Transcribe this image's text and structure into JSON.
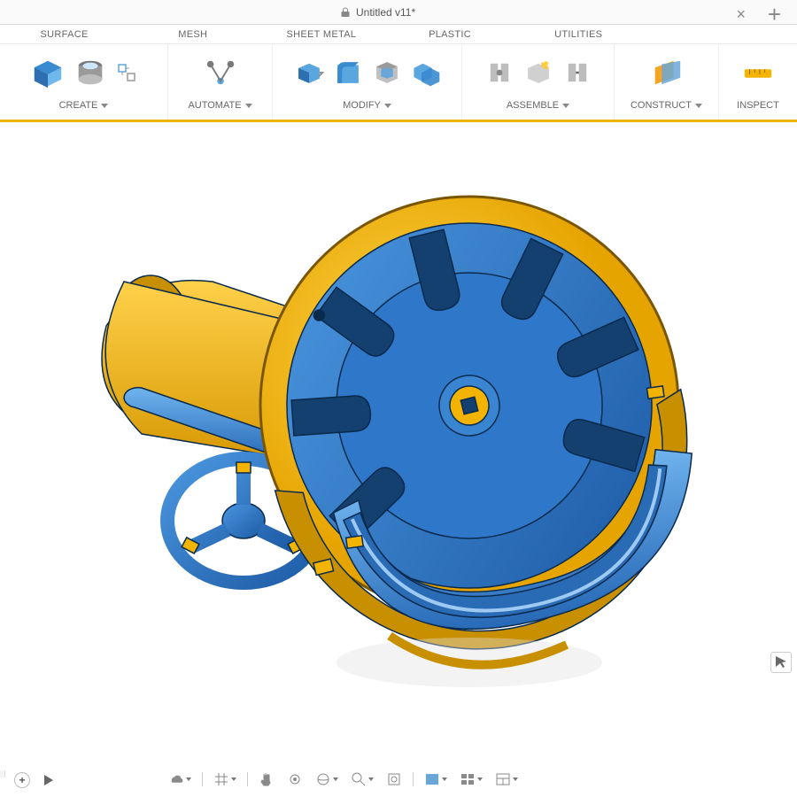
{
  "document": {
    "title": "Untitled v11*",
    "close": "×",
    "add": "+"
  },
  "panels": [
    "SURFACE",
    "MESH",
    "SHEET METAL",
    "PLASTIC",
    "UTILITIES"
  ],
  "ribbon": {
    "create": {
      "label": "CREATE"
    },
    "automate": {
      "label": "AUTOMATE"
    },
    "modify": {
      "label": "MODIFY"
    },
    "assemble": {
      "label": "ASSEMBLE"
    },
    "construct": {
      "label": "CONSTRUCT"
    },
    "inspect": {
      "label": "INSPECT"
    }
  },
  "browser": {
    "collapse": "–",
    "paren": ")"
  },
  "timeline": {
    "expand": "+"
  },
  "navbar": {
    "items": [
      "display-settings",
      "grid",
      "pan",
      "look",
      "orbit",
      "zoom",
      "fit",
      "viewport-single",
      "viewport-quad",
      "layout"
    ]
  },
  "colors": {
    "blue": "#2d7fd6",
    "darkblue": "#1e5ba9",
    "yellow": "#f2b400",
    "darkyellow": "#c88f00",
    "edge": "#0a2a4d"
  }
}
